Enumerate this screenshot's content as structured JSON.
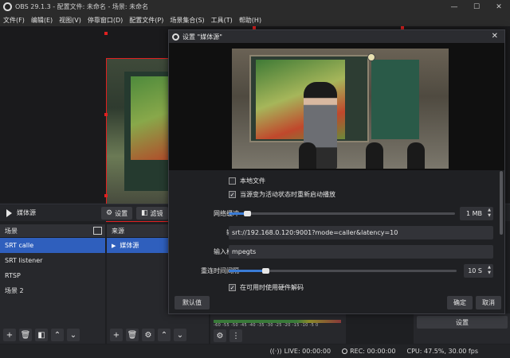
{
  "window": {
    "title": "OBS 29.1.3 - 配置文件: 未命名 - 场景: 未命名",
    "minimize": "—",
    "maximize": "☐",
    "close": "✕"
  },
  "menu": [
    "文件(F)",
    "编辑(E)",
    "视图(V)",
    "停靠窗口(D)",
    "配置文件(P)",
    "场景集合(S)",
    "工具(T)",
    "帮助(H)"
  ],
  "source_bar": {
    "source_name": "媒体源",
    "settings_label": "设置",
    "filters_label": "滤镜"
  },
  "scenes": {
    "title": "场景",
    "items": [
      {
        "label": "SRT calle",
        "active": true
      },
      {
        "label": "SRT listener",
        "active": false
      },
      {
        "label": "RTSP",
        "active": false
      },
      {
        "label": "场景 2",
        "active": false
      }
    ]
  },
  "sources": {
    "title": "来源",
    "items": [
      {
        "label": "媒体源",
        "active": true
      }
    ]
  },
  "mixer": {
    "scale": "-60 -55 -50 -45 -40 -35 -30 -25 -20 -15 -10 -5 0"
  },
  "controls": {
    "settings_label": "设置"
  },
  "status": {
    "live": "LIVE: 00:00:00",
    "rec": "REC: 00:00:00",
    "cpu": "CPU: 47.5%, 30.00 fps"
  },
  "dialog": {
    "title": "设置 \"媒体源\"",
    "close": "✕",
    "local_file_label": "本地文件",
    "local_file_checked": false,
    "restart_label": "当源变为活动状态时重新启动播放",
    "restart_checked": true,
    "network_buffer_label": "网络缓冲",
    "network_buffer_value": "1 MB",
    "network_buffer_fraction": 0.08,
    "input_label": "输入",
    "input_value": "srt://192.168.0.120:9001?mode=caller&latency=10",
    "input_format_label": "输入格式",
    "input_format_value": "mpegts",
    "reconnect_label": "重连时间间隔",
    "reconnect_value": "10 S",
    "reconnect_fraction": 0.16,
    "hw_decode_label": "在可用时使用硬件解码",
    "hw_decode_checked": true,
    "defaults_label": "默认值",
    "ok_label": "确定",
    "cancel_label": "取消",
    "check_glyph": "✓"
  }
}
